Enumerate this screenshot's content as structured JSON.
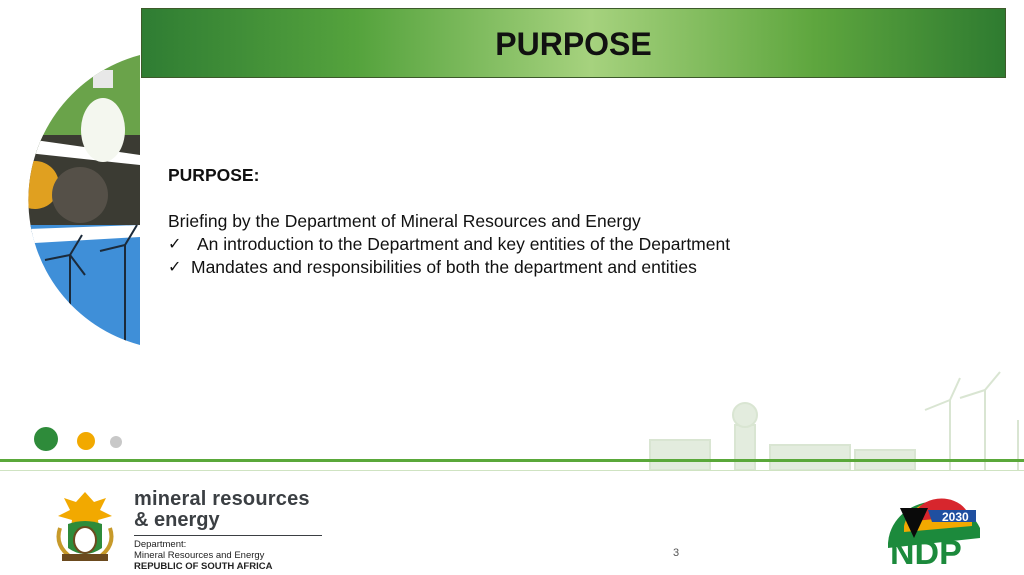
{
  "slide": {
    "title": "PURPOSE",
    "heading": "PURPOSE:",
    "intro": "Briefing by the Department of Mineral Resources and Energy",
    "bullets": [
      "An introduction to the Department and key entities of the Department",
      "Mandates and responsibilities of both the department and entities"
    ],
    "page_number": "3"
  },
  "footer": {
    "brand_line1": "mineral resources",
    "brand_line2": "& energy",
    "dept_label": "Department:",
    "dept_name": "Mineral Resources and Energy",
    "country": "REPUBLIC OF SOUTH AFRICA",
    "ndp_year": "2030",
    "ndp_text": "NDP"
  },
  "colors": {
    "accent_green": "#5aa83a",
    "dot_green": "#2e8b3a",
    "dot_yellow": "#f2a900",
    "dot_grey": "#c8c8c8"
  },
  "icons": {
    "check": "✓"
  }
}
